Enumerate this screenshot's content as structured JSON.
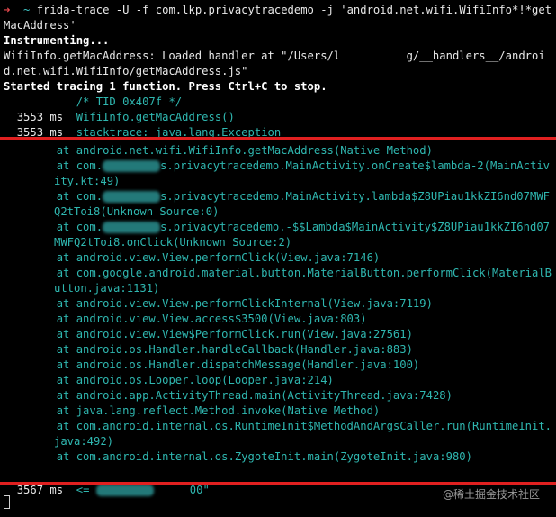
{
  "prompt": {
    "arrow": "➜",
    "dir": "~"
  },
  "command": "frida-trace -U -f com.lkp.privacytracedemo -j 'android.net.wifi.WifiInfo*!*getMacAddress'",
  "output": {
    "instrumenting": "Instrumenting...",
    "loaded": "WifiInfo.getMacAddress: Loaded handler at \"/Users/l          g/__handlers__/android.net.wifi.WifiInfo/getMacAddress.js\"",
    "started": "Started tracing 1 function. Press Ctrl+C to stop."
  },
  "trace": {
    "tid_comment": "/* TID 0x407f */",
    "entry_time": "3553 ms",
    "entry_call": "WifiInfo.getMacAddress()",
    "stack_time": "3553 ms",
    "stack_label": "stacktrace: java.lang.Exception",
    "frames": [
      {
        "pre": "at android.net.wifi.WifiInfo.getMacAddress(Native Method)"
      },
      {
        "pre": "at com.",
        "post": "s.privacytracedemo.MainActivity.onCreate$lambda-2(MainActivity.kt:49)"
      },
      {
        "pre": "at com.",
        "post": "s.privacytracedemo.MainActivity.lambda$Z8UPiau1kkZI6nd07MWFQ2tToi8(Unknown Source:0)"
      },
      {
        "pre": "at com.",
        "post": "s.privacytracedemo.-$$Lambda$MainActivity$Z8UPiau1kkZI6nd07MWFQ2tToi8.onClick(Unknown Source:2)"
      },
      {
        "pre": "at android.view.View.performClick(View.java:7146)"
      },
      {
        "pre": "at com.google.android.material.button.MaterialButton.performClick(MaterialButton.java:1131)"
      },
      {
        "pre": "at android.view.View.performClickInternal(View.java:7119)"
      },
      {
        "pre": "at android.view.View.access$3500(View.java:803)"
      },
      {
        "pre": "at android.view.View$PerformClick.run(View.java:27561)"
      },
      {
        "pre": "at android.os.Handler.handleCallback(Handler.java:883)"
      },
      {
        "pre": "at android.os.Handler.dispatchMessage(Handler.java:100)"
      },
      {
        "pre": "at android.os.Looper.loop(Looper.java:214)"
      },
      {
        "pre": "at android.app.ActivityThread.main(ActivityThread.java:7428)"
      },
      {
        "pre": "at java.lang.reflect.Method.invoke(Native Method)"
      },
      {
        "pre": "at com.android.internal.os.RuntimeInit$MethodAndArgsCaller.run(RuntimeInit.java:492)"
      },
      {
        "pre": "at com.android.internal.os.ZygoteInit.main(ZygoteInit.java:980)"
      }
    ],
    "return_time": "3567 ms",
    "return_arrow": "<=",
    "return_suffix": "00\""
  },
  "watermark": "@稀土掘金技术社区",
  "colors": {
    "teal": "#2fb7b0",
    "red_highlight": "#e02020",
    "prompt_red": "#e5484d"
  }
}
